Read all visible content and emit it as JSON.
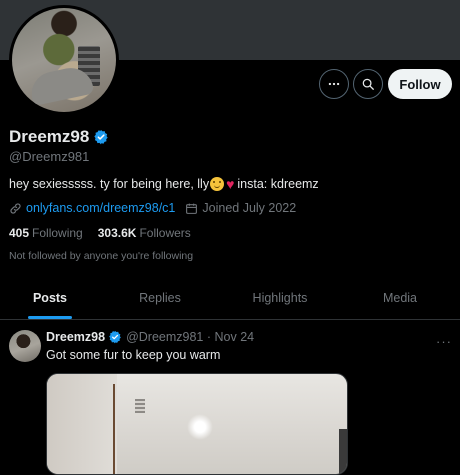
{
  "profile": {
    "display_name": "Dreemz98",
    "handle": "@Dreemz981",
    "bio_text": "hey sexiesssss. ty for being here, lly",
    "bio_insta": "insta: kdreemz",
    "link_text": "onlyfans.com/dreemz98/c1",
    "joined": "Joined July 2022",
    "following_count": "405",
    "following_label": "Following",
    "followers_count": "303.6K",
    "followers_label": "Followers",
    "not_followed": "Not followed by anyone you're following"
  },
  "actions": {
    "follow_label": "Follow",
    "more_icon": "more-horizontal-icon",
    "search_icon": "search-icon"
  },
  "tabs": [
    {
      "label": "Posts",
      "active": true
    },
    {
      "label": "Replies",
      "active": false
    },
    {
      "label": "Highlights",
      "active": false
    },
    {
      "label": "Media",
      "active": false
    }
  ],
  "post": {
    "name": "Dreemz98",
    "handle_time": "@Dreemz981 · Nov 24",
    "text": "Got some fur to keep you warm",
    "more": "···"
  },
  "colors": {
    "background": "#000000",
    "accent": "#1d9bf0",
    "muted": "#71767b",
    "follow_bg": "#eff3f4"
  }
}
